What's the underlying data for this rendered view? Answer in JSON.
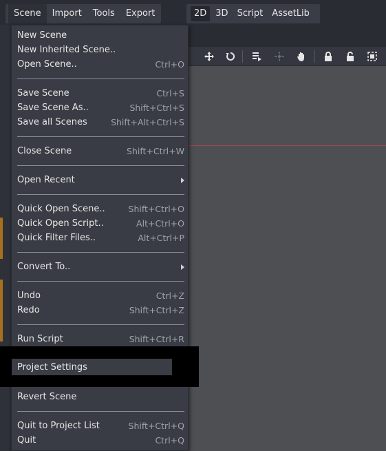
{
  "menubar": {
    "items": [
      "Scene",
      "Import",
      "Tools",
      "Export"
    ]
  },
  "modes": {
    "items": [
      "2D",
      "3D",
      "Script",
      "AssetLib"
    ],
    "active": "2D"
  },
  "toolbar": {
    "icons": [
      "move-icon",
      "rotate-icon",
      "list-icon",
      "pivot-icon",
      "pan-hand-icon",
      "lock-icon",
      "unlock-icon",
      "group-icon"
    ]
  },
  "scene_menu": {
    "new_scene": {
      "label": "New Scene",
      "shortcut": ""
    },
    "new_inherited_scene": {
      "label": "New Inherited Scene..",
      "shortcut": ""
    },
    "open_scene": {
      "label": "Open Scene..",
      "shortcut": "Ctrl+O"
    },
    "save_scene": {
      "label": "Save Scene",
      "shortcut": "Ctrl+S"
    },
    "save_scene_as": {
      "label": "Save Scene As..",
      "shortcut": "Shift+Ctrl+S"
    },
    "save_all_scenes": {
      "label": "Save all Scenes",
      "shortcut": "Shift+Alt+Ctrl+S"
    },
    "close_scene": {
      "label": "Close Scene",
      "shortcut": "Shift+Ctrl+W"
    },
    "open_recent": {
      "label": "Open Recent",
      "shortcut": ""
    },
    "quick_open_scene": {
      "label": "Quick Open Scene..",
      "shortcut": "Shift+Ctrl+O"
    },
    "quick_open_script": {
      "label": "Quick Open Script..",
      "shortcut": "Alt+Ctrl+O"
    },
    "quick_filter_files": {
      "label": "Quick Filter Files..",
      "shortcut": "Alt+Ctrl+P"
    },
    "convert_to": {
      "label": "Convert To..",
      "shortcut": ""
    },
    "undo": {
      "label": "Undo",
      "shortcut": "Ctrl+Z"
    },
    "redo": {
      "label": "Redo",
      "shortcut": "Shift+Ctrl+Z"
    },
    "run_script": {
      "label": "Run Script",
      "shortcut": "Shift+Ctrl+R"
    },
    "project_settings": {
      "label": "Project Settings",
      "shortcut": ""
    },
    "revert_scene": {
      "label": "Revert Scene",
      "shortcut": ""
    },
    "quit_to_project_list": {
      "label": "Quit to Project List",
      "shortcut": "Shift+Ctrl+Q"
    },
    "quit": {
      "label": "Quit",
      "shortcut": "Ctrl+Q"
    }
  },
  "colors": {
    "menu_bg": "#393c44",
    "viewport_bg": "#4e4f53",
    "highlight_overlay": "#000000",
    "origin_line": "#a04a4a"
  }
}
